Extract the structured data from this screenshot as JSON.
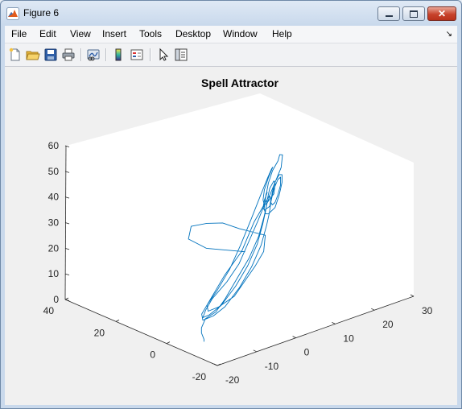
{
  "window": {
    "title": "Figure 6"
  },
  "menu": [
    "File",
    "Edit",
    "View",
    "Insert",
    "Tools",
    "Desktop",
    "Window",
    "Help"
  ],
  "toolbar_icons": [
    "new-figure-icon",
    "open-file-icon",
    "save-icon",
    "print-icon",
    "link-plot-icon",
    "colorbar-icon",
    "legend-icon",
    "edit-plot-arrow-icon",
    "property-inspector-icon"
  ],
  "colors": {
    "line": "#0072bd",
    "axes_bg": "#ffffff",
    "figure_bg": "#f0f0f0"
  },
  "chart_data": {
    "type": "line",
    "projection": "3d",
    "title": "Spell Attractor",
    "xlabel": "",
    "ylabel": "",
    "zlabel": "",
    "xlim": [
      -20,
      30
    ],
    "ylim": [
      -20,
      40
    ],
    "zlim": [
      0,
      60
    ],
    "xticks": [
      -20,
      -10,
      0,
      10,
      20,
      30
    ],
    "yticks": [
      -20,
      0,
      20,
      40
    ],
    "zticks": [
      0,
      10,
      20,
      30,
      40,
      50,
      60
    ],
    "grid": false,
    "series": [
      {
        "points": [
          [
            0,
            0,
            25
          ],
          [
            -6,
            6,
            27
          ],
          [
            -8,
            10,
            30
          ],
          [
            -6,
            12,
            33
          ],
          [
            -2,
            12,
            32
          ],
          [
            2,
            12,
            30
          ],
          [
            5,
            10,
            27
          ],
          [
            9,
            6,
            24
          ],
          [
            6,
            2,
            21
          ],
          [
            2,
            -1,
            19
          ],
          [
            -2,
            -3,
            16
          ],
          [
            -6,
            -5,
            13
          ],
          [
            -10,
            -5,
            11
          ],
          [
            -12,
            -4,
            10
          ],
          [
            -11,
            -2,
            11
          ],
          [
            -9,
            -1,
            13
          ],
          [
            -4,
            2,
            17
          ],
          [
            3,
            6,
            21
          ],
          [
            10,
            12,
            26
          ],
          [
            18,
            18,
            30
          ],
          [
            24,
            23,
            35
          ],
          [
            25,
            24,
            39
          ],
          [
            23,
            22,
            41
          ],
          [
            20,
            18,
            42
          ],
          [
            16,
            14,
            42
          ],
          [
            13,
            11,
            40
          ],
          [
            11,
            9,
            36
          ],
          [
            10,
            8,
            33
          ],
          [
            11,
            9,
            30
          ],
          [
            13,
            11,
            28
          ],
          [
            16,
            13,
            28
          ],
          [
            19,
            16,
            30
          ],
          [
            21,
            18,
            33
          ],
          [
            21,
            18,
            36
          ],
          [
            19,
            16,
            38
          ],
          [
            16,
            13,
            38
          ],
          [
            14,
            11,
            36
          ],
          [
            13,
            10,
            33
          ],
          [
            14,
            11,
            31
          ],
          [
            16,
            13,
            30
          ],
          [
            18,
            15,
            31
          ],
          [
            20,
            17,
            33
          ],
          [
            20,
            17,
            36
          ],
          [
            18,
            15,
            37
          ],
          [
            15,
            12,
            36
          ],
          [
            13,
            10,
            33
          ],
          [
            12,
            9,
            30
          ],
          [
            10,
            7,
            27
          ],
          [
            6,
            3,
            23
          ],
          [
            1,
            -1,
            19
          ],
          [
            -4,
            -4,
            15
          ],
          [
            -9,
            -6,
            11
          ],
          [
            -12,
            -6,
            9
          ],
          [
            -14,
            -5,
            8
          ],
          [
            -13,
            -3,
            9
          ],
          [
            -11,
            -2,
            11
          ],
          [
            -7,
            0,
            14
          ],
          [
            -2,
            3,
            18
          ],
          [
            4,
            8,
            22
          ],
          [
            10,
            13,
            27
          ],
          [
            15,
            17,
            32
          ],
          [
            18,
            19,
            36
          ],
          [
            19,
            19,
            39
          ],
          [
            18,
            17,
            41
          ],
          [
            15,
            14,
            40
          ],
          [
            12,
            11,
            38
          ],
          [
            11,
            10,
            35
          ],
          [
            12,
            11,
            32
          ],
          [
            14,
            13,
            31
          ],
          [
            17,
            15,
            32
          ],
          [
            18,
            16,
            35
          ],
          [
            17,
            15,
            37
          ],
          [
            14,
            12,
            37
          ],
          [
            12,
            10,
            34
          ],
          [
            11,
            9,
            31
          ],
          [
            9,
            7,
            28
          ],
          [
            5,
            3,
            24
          ],
          [
            0,
            -1,
            20
          ],
          [
            -5,
            -4,
            16
          ],
          [
            -10,
            -6,
            12
          ],
          [
            -13,
            -6,
            10
          ],
          [
            -14,
            -5,
            9
          ],
          [
            -12,
            -3,
            10
          ],
          [
            -9,
            -1,
            12
          ],
          [
            -4,
            1,
            15
          ],
          [
            1,
            4,
            18
          ],
          [
            6,
            8,
            22
          ],
          [
            11,
            12,
            26
          ],
          [
            14,
            14,
            30
          ],
          [
            15,
            15,
            33
          ],
          [
            14,
            13,
            35
          ],
          [
            12,
            11,
            34
          ],
          [
            11,
            10,
            32
          ],
          [
            12,
            11,
            30
          ],
          [
            14,
            12,
            30
          ],
          [
            15,
            13,
            32
          ],
          [
            14,
            12,
            34
          ],
          [
            12,
            10,
            33
          ],
          [
            10,
            8,
            30
          ],
          [
            6,
            4,
            26
          ],
          [
            1,
            0,
            22
          ],
          [
            -4,
            -3,
            18
          ],
          [
            -9,
            -6,
            14
          ],
          [
            -12,
            -7,
            11
          ],
          [
            -14,
            -6,
            9
          ],
          [
            -15,
            -6,
            6
          ],
          [
            -15,
            -6,
            4
          ],
          [
            -15,
            -7,
            2
          ],
          [
            -15,
            -7,
            1
          ]
        ]
      }
    ]
  }
}
